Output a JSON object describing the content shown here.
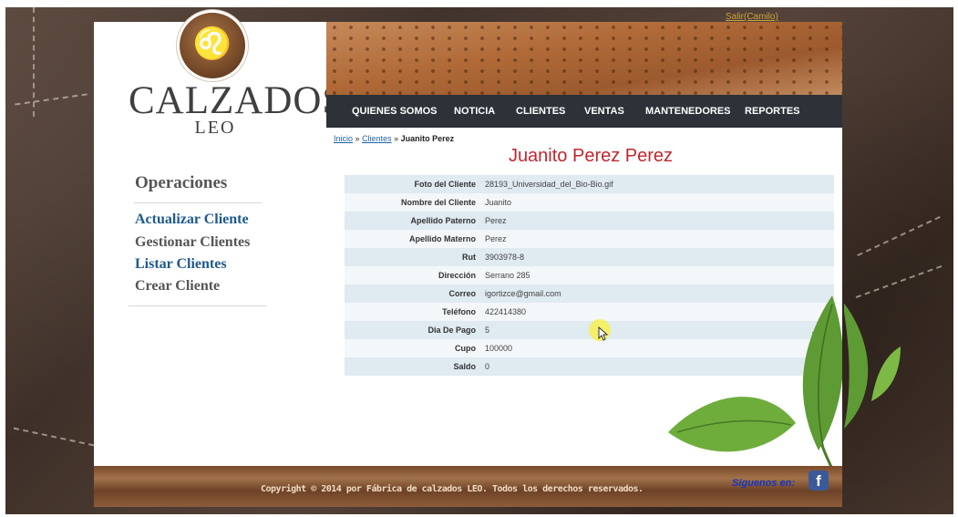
{
  "header": {
    "logout_link": "Salir(Camilo)",
    "logo_text": "CALZADOS",
    "logo_subtext": "LEO"
  },
  "nav": {
    "items": [
      "QUIENES SOMOS",
      "NOTICIA",
      "CLIENTES",
      "VENTAS",
      "MANTENEDORES",
      "REPORTES"
    ]
  },
  "breadcrumb": {
    "items": [
      "Inicio",
      "Clientes"
    ],
    "separator": "»",
    "current": "Juanito Perez"
  },
  "page_title": "Juanito Perez Perez",
  "sidebar": {
    "heading": "Operaciones",
    "links": [
      "Actualizar Cliente",
      "Gestionar Clientes",
      "Listar Clientes",
      "Crear Cliente"
    ]
  },
  "details": [
    {
      "label": "Foto del Cliente",
      "value": "28193_Universidad_del_Bio-Bio.gif"
    },
    {
      "label": "Nombre del Cliente",
      "value": "Juanito"
    },
    {
      "label": "Apellido Paterno",
      "value": "Perez"
    },
    {
      "label": "Apellido Materno",
      "value": "Perez"
    },
    {
      "label": "Rut",
      "value": "3903978-8"
    },
    {
      "label": "Dirección",
      "value": "Serrano 285"
    },
    {
      "label": "Correo",
      "value": "igortizce@gmail.com"
    },
    {
      "label": "Teléfono",
      "value": "422414380"
    },
    {
      "label": "Dia De Pago",
      "value": "5"
    },
    {
      "label": "Cupo",
      "value": "100000"
    },
    {
      "label": "Saldo",
      "value": "0"
    }
  ],
  "footer": {
    "copyright": "Copyright © 2014 por Fábrica de calzados LEO. Todos los derechos reservados.",
    "follow_label": "Siguenos en:",
    "facebook_icon": "facebook-icon"
  },
  "colors": {
    "nav_bg": "#2c3238",
    "title_red": "#c0262d",
    "link_blue": "#1e5a8c",
    "link_gray": "#555555"
  }
}
